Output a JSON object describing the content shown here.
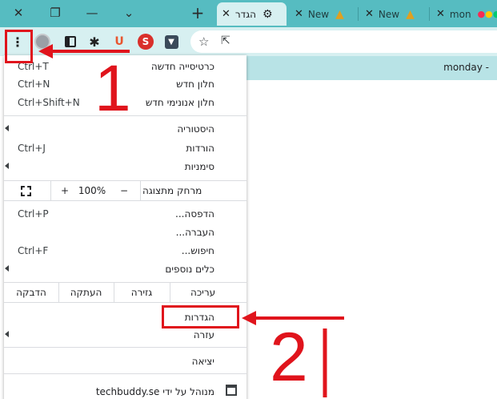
{
  "tabs": [
    {
      "label": "הגדר",
      "active": true,
      "icon": "gear-icon"
    },
    {
      "label": "New",
      "active": false,
      "icon": "app-logo-icon"
    },
    {
      "label": "New",
      "active": false,
      "icon": "app-logo-icon"
    },
    {
      "label": "mon",
      "active": false,
      "icon": "monday-logo-icon"
    }
  ],
  "window": {
    "close": "✕",
    "restore": "❐",
    "minimize": "—",
    "tab_search": "⌄",
    "new_tab": "+"
  },
  "bookmarks": {
    "item": "monday -"
  },
  "menu": {
    "new_tab": "כרטיסייה חדשה",
    "new_tab_sc": "Ctrl+T",
    "new_window": "חלון חדש",
    "new_window_sc": "Ctrl+N",
    "incognito": "חלון אנונימי חדש",
    "incognito_sc": "Ctrl+Shift+N",
    "history": "היסטוריה",
    "downloads": "הורדות",
    "downloads_sc": "Ctrl+J",
    "bookmarks": "סימניות",
    "zoom_label": "מרחק מתצוגה",
    "zoom_minus": "−",
    "zoom_value": "100%",
    "zoom_plus": "+",
    "print": "הדפסה...",
    "print_sc": "Ctrl+P",
    "cast": "העברה...",
    "find": "חיפוש...",
    "find_sc": "Ctrl+F",
    "more_tools": "כלים נוספים",
    "edit_label": "עריכה",
    "cut": "גזירה",
    "copy": "העתקה",
    "paste": "הדבקה",
    "settings": "הגדרות",
    "help": "עזרה",
    "exit": "יציאה",
    "managed": "מנוהל על ידי techbuddy.se"
  },
  "annotations": {
    "step1": "1",
    "step2": "2"
  },
  "colors": {
    "tabstrip": "#56bcc1",
    "toolbar": "#d7f0f1",
    "annotation": "#e0141c"
  }
}
